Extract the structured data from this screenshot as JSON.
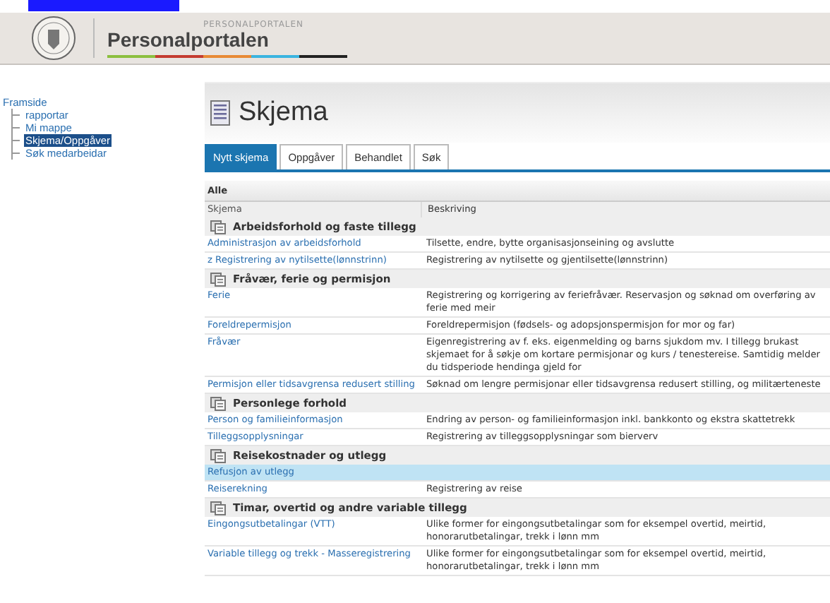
{
  "header": {
    "kicker": "PERSONALPORTALEN",
    "title": "Personalportalen"
  },
  "nav": {
    "items": [
      {
        "label": "Framside",
        "selected": false,
        "children": [
          {
            "label": "rapportar",
            "selected": false
          },
          {
            "label": "Mi mappe",
            "selected": false
          },
          {
            "label": "Skjema/Oppgåver",
            "selected": true
          },
          {
            "label": "Søk medarbeidar",
            "selected": false
          }
        ]
      }
    ]
  },
  "page": {
    "title": "Skjema",
    "tabs": [
      {
        "label": "Nytt skjema",
        "selected": true
      },
      {
        "label": "Oppgåver",
        "selected": false
      },
      {
        "label": "Behandlet",
        "selected": false
      },
      {
        "label": "Søk",
        "selected": false
      }
    ],
    "table": {
      "caption": "Alle",
      "columns": [
        "Skjema",
        "Beskriving"
      ],
      "groups": [
        {
          "title": "Arbeidsforhold og faste tillegg",
          "rows": [
            {
              "name": "Administrasjon av arbeidsforhold",
              "description": "Tilsette, endre, bytte organisasjonseining og avslutte",
              "selected": false
            },
            {
              "name": "z Registrering av nytilsette(lønnstrinn)",
              "description": "Registrering av nytilsette og gjentilsette(lønnstrinn)",
              "selected": false
            }
          ]
        },
        {
          "title": "Fråvær, ferie og permisjon",
          "rows": [
            {
              "name": "Ferie",
              "description": "Registrering og korrigering av feriefråvær. Reservasjon og søknad om overføring av ferie med meir",
              "selected": false
            },
            {
              "name": "Foreldrepermisjon",
              "description": "Foreldrepermisjon (fødsels- og adopsjonspermisjon for mor og far)",
              "selected": false
            },
            {
              "name": "Fråvær",
              "description": "Eigenregistrering av f. eks. eigenmelding og barns sjukdom mv. I tillegg brukast skjemaet for å søkje om kortare permisjonar og kurs / tenestereise. Samtidig melder du tidsperiode hendinga gjeld for",
              "selected": false
            },
            {
              "name": "Permisjon eller tidsavgrensa redusert stilling",
              "description": "Søknad om lengre permisjonar eller tidsavgrensa redusert stilling, og militærteneste",
              "selected": false
            }
          ]
        },
        {
          "title": "Personlege forhold",
          "rows": [
            {
              "name": "Person og familieinformasjon",
              "description": "Endring av person- og familieinformasjon inkl. bankkonto og ekstra skattetrekk",
              "selected": false
            },
            {
              "name": "Tilleggsopplysningar",
              "description": "Registrering av tilleggsopplysningar som bierverv",
              "selected": false
            }
          ]
        },
        {
          "title": "Reisekostnader og utlegg",
          "rows": [
            {
              "name": "Refusjon av utlegg",
              "description": "",
              "selected": true
            },
            {
              "name": "Reiserekning",
              "description": "Registrering av reise",
              "selected": false
            }
          ]
        },
        {
          "title": "Timar, overtid og andre variable tillegg",
          "rows": [
            {
              "name": "Eingongsutbetalingar (VTT)",
              "description": "Ulike former for eingongsutbetalingar som for eksempel overtid, meirtid, honorarutbetalingar, trekk i lønn mm",
              "selected": false
            },
            {
              "name": "Variable tillegg og trekk - Masseregistrering",
              "description": "Ulike former for eingongsutbetalingar som for eksempel overtid, meirtid, honorarutbetalingar, trekk i lønn mm",
              "selected": false
            }
          ]
        }
      ]
    }
  }
}
